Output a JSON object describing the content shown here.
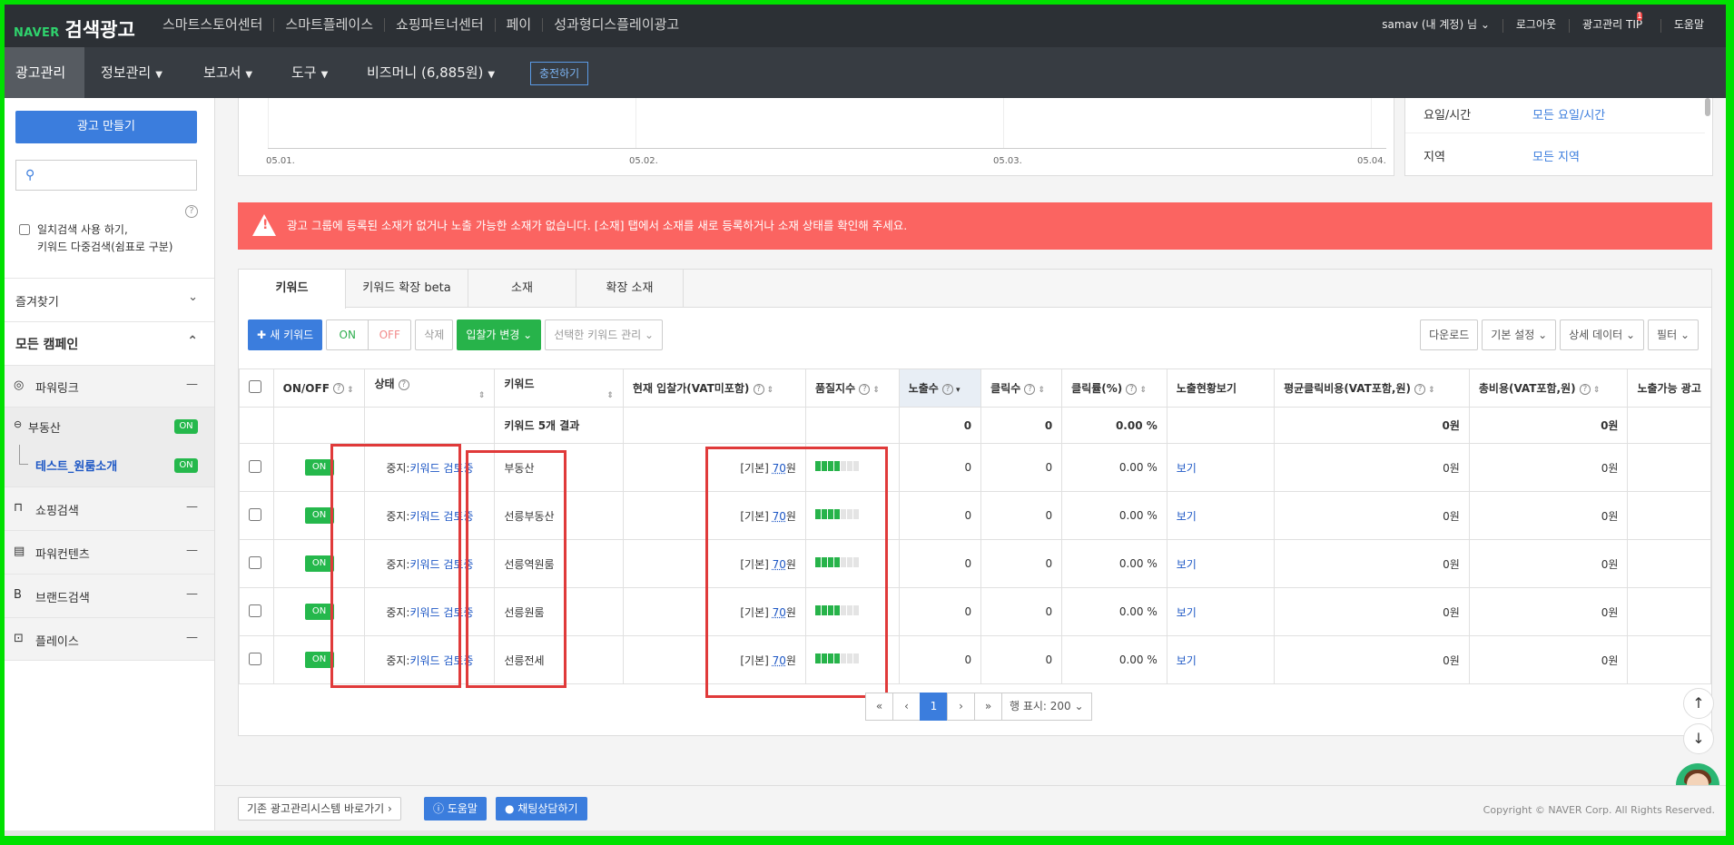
{
  "topbar": {
    "brand": "NAVER",
    "title": "검색광고",
    "nav": [
      "스마트스토어센터",
      "스마트플레이스",
      "쇼핑파트너센터",
      "페이",
      "성과형디스플레이광고"
    ],
    "account": "samav (내 계정) 님 ⌄",
    "logout": "로그아웃",
    "tip": "광고관리 TIP",
    "tip_badge": "1",
    "help": "도움말"
  },
  "subnav": {
    "items": [
      "광고관리",
      "정보관리",
      "보고서",
      "도구",
      "비즈머니 (6,885원)"
    ],
    "charge": "충전하기"
  },
  "sidebar": {
    "make_ad": "광고 만들기",
    "search_placeholder": "",
    "exact_search_line1": "일치검색 사용 하기,",
    "exact_search_line2": "키워드 다중검색(쉼표로 구분)",
    "favorites": "즐겨찾기",
    "all_campaigns": "모든 캠페인",
    "powerlink": "파워링크",
    "campaign": "부동산",
    "campaign_status": "ON",
    "adgroup": "테스트_원룸소개",
    "adgroup_status": "ON",
    "shopping": "쇼핑검색",
    "powercontents": "파워컨텐츠",
    "brand": "브랜드검색",
    "place": "플레이스"
  },
  "chart": {
    "ticks": [
      "05.01.",
      "05.02.",
      "05.03.",
      "05.04."
    ]
  },
  "filter": {
    "day_time_label": "요일/시간",
    "day_time_value": "모든 요일/시간",
    "region_label": "지역",
    "region_value": "모든 지역"
  },
  "alert": {
    "text": "광고 그룹에 등록된 소재가 없거나 노출 가능한 소재가 없습니다. [소재] 탭에서 소재를 새로 등록하거나 소재 상태를 확인해 주세요."
  },
  "tabs": [
    "키워드",
    "키워드 확장 beta",
    "소재",
    "확장 소재"
  ],
  "toolbar": {
    "new_keyword": "새 키워드",
    "on": "ON",
    "off": "OFF",
    "delete": "삭제",
    "bid_change": "입찰가 변경",
    "manage_selected": "선택한 키워드 관리",
    "download": "다운로드",
    "default_settings": "기본 설정",
    "detail_data": "상세 데이터",
    "filter": "필터"
  },
  "table": {
    "headers": {
      "onoff": "ON/OFF",
      "status": "상태",
      "keyword": "키워드",
      "bid": "현재 입찰가(VAT미포함)",
      "quality": "품질지수",
      "impressions": "노출수",
      "clicks": "클릭수",
      "ctr": "클릭률(%)",
      "view_exposure": "노출현황보기",
      "avg_cpc": "평균클릭비용(VAT포함,원)",
      "total_cost": "총비용(VAT포함,원)",
      "possible": "노출가능 광고"
    },
    "summary": {
      "label": "키워드 5개 결과",
      "impressions": "0",
      "clicks": "0",
      "ctr": "0.00 %",
      "avg_cpc": "0원",
      "total_cost": "0원"
    },
    "rows": [
      {
        "onoff": "ON",
        "status_prefix": "중지:",
        "status_link": "키워드 검토중",
        "keyword": "부동산",
        "bid_prefix": "[기본]",
        "bid_value": "70",
        "bid_unit": "원",
        "quality": 4,
        "impressions": "0",
        "clicks": "0",
        "ctr": "0.00 %",
        "view": "보기",
        "avg_cpc": "0원",
        "total_cost": "0원"
      },
      {
        "onoff": "ON",
        "status_prefix": "중지:",
        "status_link": "키워드 검토중",
        "keyword": "선릉부동산",
        "bid_prefix": "[기본]",
        "bid_value": "70",
        "bid_unit": "원",
        "quality": 4,
        "impressions": "0",
        "clicks": "0",
        "ctr": "0.00 %",
        "view": "보기",
        "avg_cpc": "0원",
        "total_cost": "0원"
      },
      {
        "onoff": "ON",
        "status_prefix": "중지:",
        "status_link": "키워드 검토중",
        "keyword": "선릉역원룸",
        "bid_prefix": "[기본]",
        "bid_value": "70",
        "bid_unit": "원",
        "quality": 4,
        "impressions": "0",
        "clicks": "0",
        "ctr": "0.00 %",
        "view": "보기",
        "avg_cpc": "0원",
        "total_cost": "0원"
      },
      {
        "onoff": "ON",
        "status_prefix": "중지:",
        "status_link": "키워드 검토중",
        "keyword": "선릉원룸",
        "bid_prefix": "[기본]",
        "bid_value": "70",
        "bid_unit": "원",
        "quality": 4,
        "impressions": "0",
        "clicks": "0",
        "ctr": "0.00 %",
        "view": "보기",
        "avg_cpc": "0원",
        "total_cost": "0원"
      },
      {
        "onoff": "ON",
        "status_prefix": "중지:",
        "status_link": "키워드 검토중",
        "keyword": "선릉전세",
        "bid_prefix": "[기본]",
        "bid_value": "70",
        "bid_unit": "원",
        "quality": 4,
        "impressions": "0",
        "clicks": "0",
        "ctr": "0.00 %",
        "view": "보기",
        "avg_cpc": "0원",
        "total_cost": "0원"
      }
    ]
  },
  "pager": {
    "first": "«",
    "prev": "‹",
    "current": "1",
    "next": "›",
    "last": "»",
    "rows_per_page": "행 표시: 200"
  },
  "footer": {
    "legacy": "기존 광고관리시스템 바로가기",
    "help": "도움말",
    "chat": "채팅상담하기",
    "copyright": "Copyright © NAVER Corp. All Rights Reserved."
  },
  "colors": {
    "accent": "#3b7ddd",
    "on_green": "#25b84c",
    "alert_red": "#fb6461",
    "highlight_box": "#e03a3a"
  }
}
